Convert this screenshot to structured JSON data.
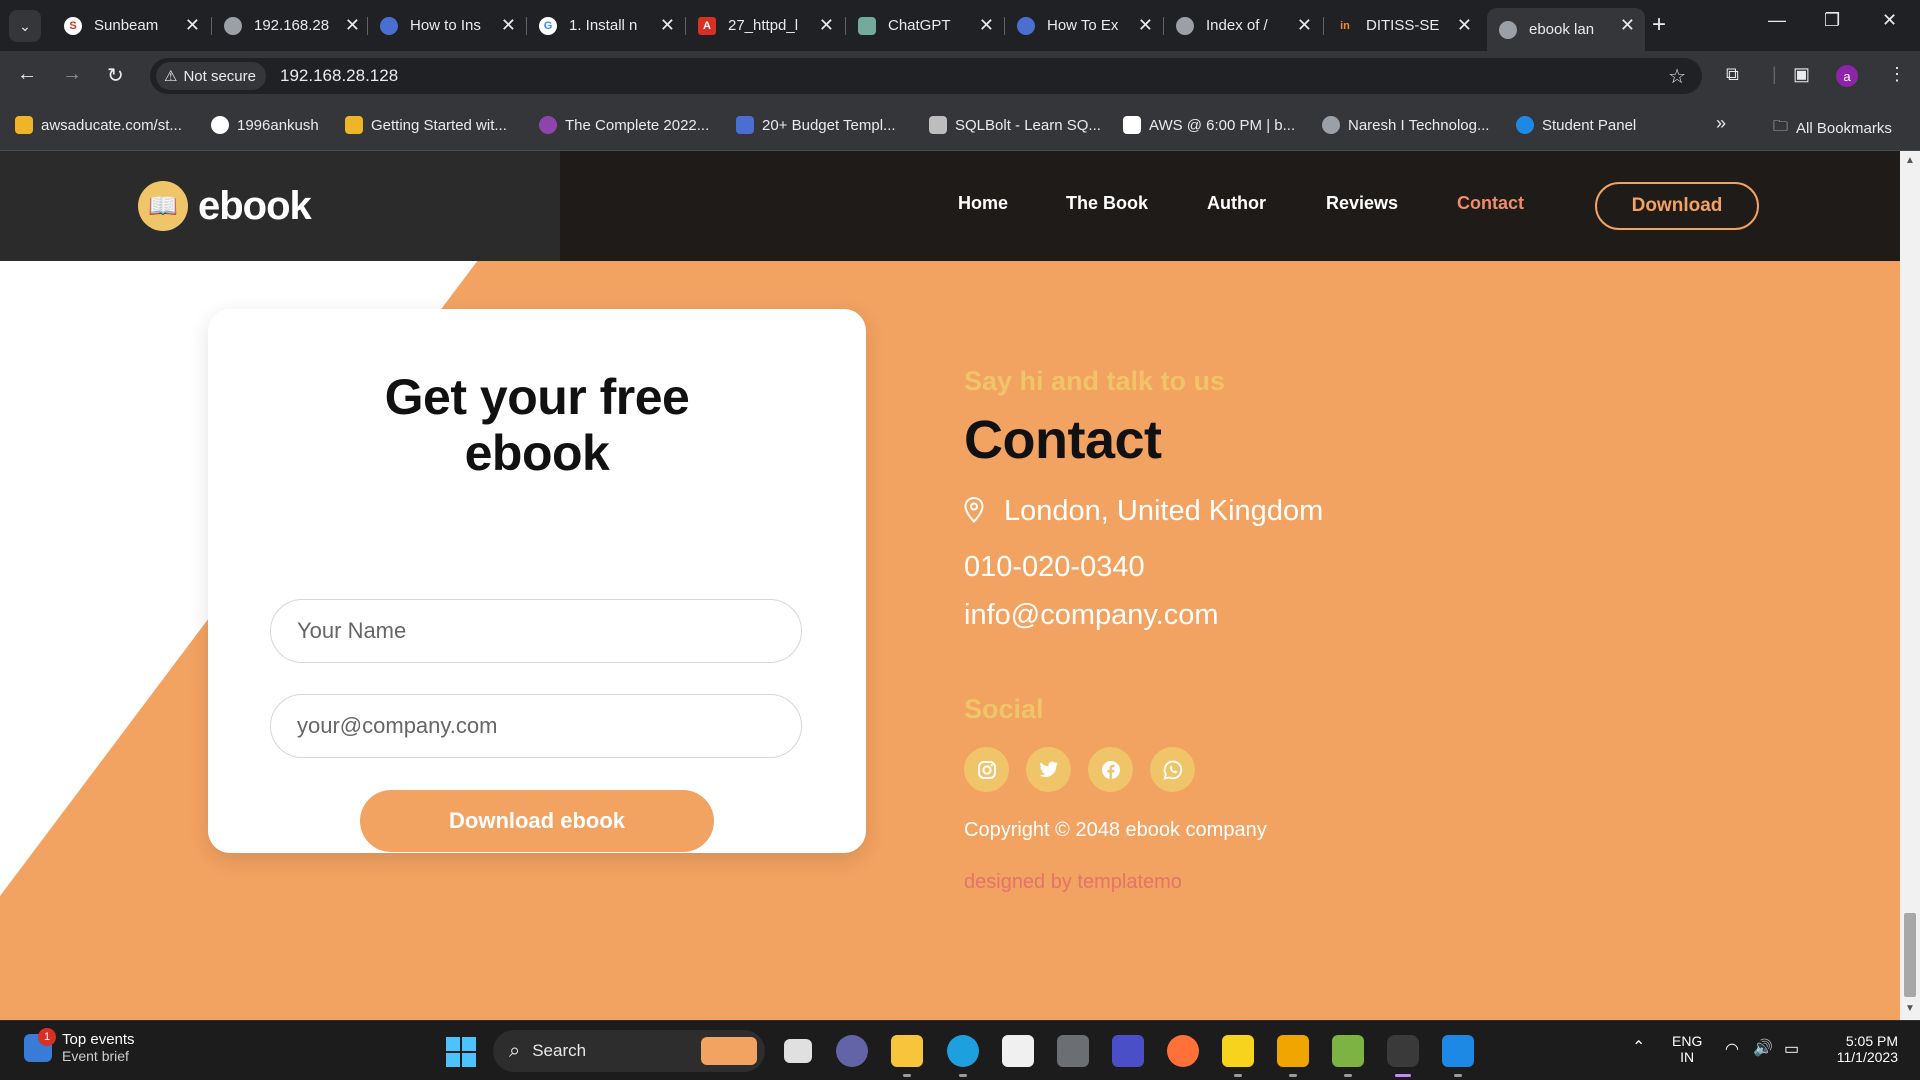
{
  "browser": {
    "tabs": [
      {
        "title": "Sunbeam",
        "favicon_color": "#ffffff",
        "active": false
      },
      {
        "title": "192.168.28",
        "favicon_color": "#9aa0a6",
        "active": false
      },
      {
        "title": "How to Ins",
        "favicon_color": "#4a6fd1",
        "active": false
      },
      {
        "title": "1. Install n",
        "favicon_color": "#ffffff",
        "active": false
      },
      {
        "title": "27_httpd_l",
        "favicon_color": "#d93025",
        "active": false
      },
      {
        "title": "ChatGPT",
        "favicon_color": "#74aa9c",
        "active": false
      },
      {
        "title": "How To Ex",
        "favicon_color": "#4a6fd1",
        "active": false
      },
      {
        "title": "Index of /",
        "favicon_color": "#9aa0a6",
        "active": false
      },
      {
        "title": "DITISS-SE",
        "favicon_color": "#f28b30",
        "active": false
      },
      {
        "title": "ebook lan",
        "favicon_color": "#9aa0a6",
        "active": true
      }
    ],
    "new_tab": "+",
    "security_label": "Not secure",
    "url": "192.168.28.128",
    "profile_initial": "a",
    "bookmarks": [
      {
        "label": "awsaducate.com/st...",
        "icon_color": "#f0b429"
      },
      {
        "label": "1996ankush",
        "icon_color": "#ffffff"
      },
      {
        "label": "Getting Started wit...",
        "icon_color": "#f0b429"
      },
      {
        "label": "The Complete 2022...",
        "icon_color": "#8e44ad"
      },
      {
        "label": "20+ Budget Templ...",
        "icon_color": "#4a6fd1"
      },
      {
        "label": "SQLBolt - Learn SQ...",
        "icon_color": "#bdbdbd"
      },
      {
        "label": "AWS @ 6:00 PM | b...",
        "icon_color": "#ffffff"
      },
      {
        "label": "Naresh I Technolog...",
        "icon_color": "#9aa0a6"
      },
      {
        "label": "Student Panel",
        "icon_color": "#1e88e5"
      }
    ],
    "all_bookmarks": "All Bookmarks",
    "more_bookmarks": "»"
  },
  "site": {
    "logo_text": "ebook",
    "nav": [
      {
        "label": "Home",
        "active": false
      },
      {
        "label": "The Book",
        "active": false
      },
      {
        "label": "Author",
        "active": false
      },
      {
        "label": "Reviews",
        "active": false
      },
      {
        "label": "Contact",
        "active": true
      }
    ],
    "download_button": "Download",
    "form": {
      "title": "Get your free ebook",
      "name_placeholder": "Your Name",
      "email_placeholder": "your@company.com",
      "submit": "Download ebook"
    },
    "contact": {
      "eyebrow": "Say hi and talk to us",
      "title": "Contact",
      "location": "London, United Kingdom",
      "phone": "010-020-0340",
      "email": "info@company.com",
      "social_heading": "Social",
      "social_icons": [
        "instagram-icon",
        "twitter-icon",
        "facebook-icon",
        "whatsapp-icon"
      ],
      "copyright": "Copyright © 2048 ebook company",
      "designed_by": "designed by templatemo"
    },
    "colors": {
      "accent": "#f2a261",
      "yellow": "#f0c56a",
      "dark": "#1f1b18",
      "link_red": "#e3746a",
      "active_nav": "#f08a6c"
    }
  },
  "taskbar": {
    "widget_title": "Top events",
    "widget_sub": "Event brief",
    "widget_badge": "1",
    "search_label": "Search",
    "lang_line1": "ENG",
    "lang_line2": "IN",
    "time": "5:05 PM",
    "date": "11/1/2023"
  }
}
